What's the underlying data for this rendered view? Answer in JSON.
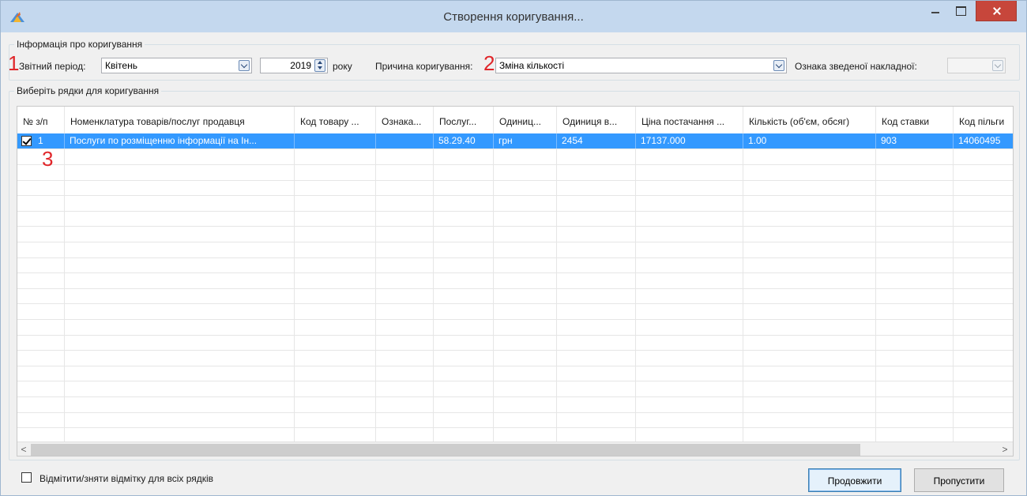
{
  "window": {
    "title": "Створення коригування..."
  },
  "info_group": {
    "caption": "Інформація про коригування",
    "period_label": "Звітний період:",
    "period_value": "Квітень",
    "year_value": "2019",
    "year_suffix": "року",
    "reason_label": "Причина коригування:",
    "reason_value": "Зміна кількості",
    "summary_label": "Ознака зведеної накладної:",
    "summary_value": ""
  },
  "annotations": [
    "1",
    "2",
    "3"
  ],
  "rows_group": {
    "caption": "Виберіть рядки для коригування"
  },
  "grid": {
    "columns": [
      "№ з/п",
      "Номенклатура товарів/послуг  продавця",
      "Код товару ...",
      "Ознака...",
      "Послуг...",
      "Одиниц...",
      "Одиниця в...",
      "Ціна постачання ...",
      "Кількість (об'єм, обсяг)",
      "Код ставки",
      "Код пільги"
    ],
    "rows": [
      {
        "checked": true,
        "cells": [
          "1",
          "Послуги по розміщенню інформації на Ін...",
          "",
          "",
          "58.29.40",
          "грн",
          "2454",
          "17137.000",
          "1.00",
          "903",
          "14060495"
        ]
      }
    ]
  },
  "footer": {
    "select_all_label": "Відмітити/зняти відмітку для всіх рядків",
    "continue_label": "Продовжити",
    "skip_label": "Пропустити"
  },
  "colors": {
    "titlebar": "#c4d8ee",
    "selection": "#3399ff",
    "close_button": "#c7463b",
    "annotation": "#e0262a"
  }
}
